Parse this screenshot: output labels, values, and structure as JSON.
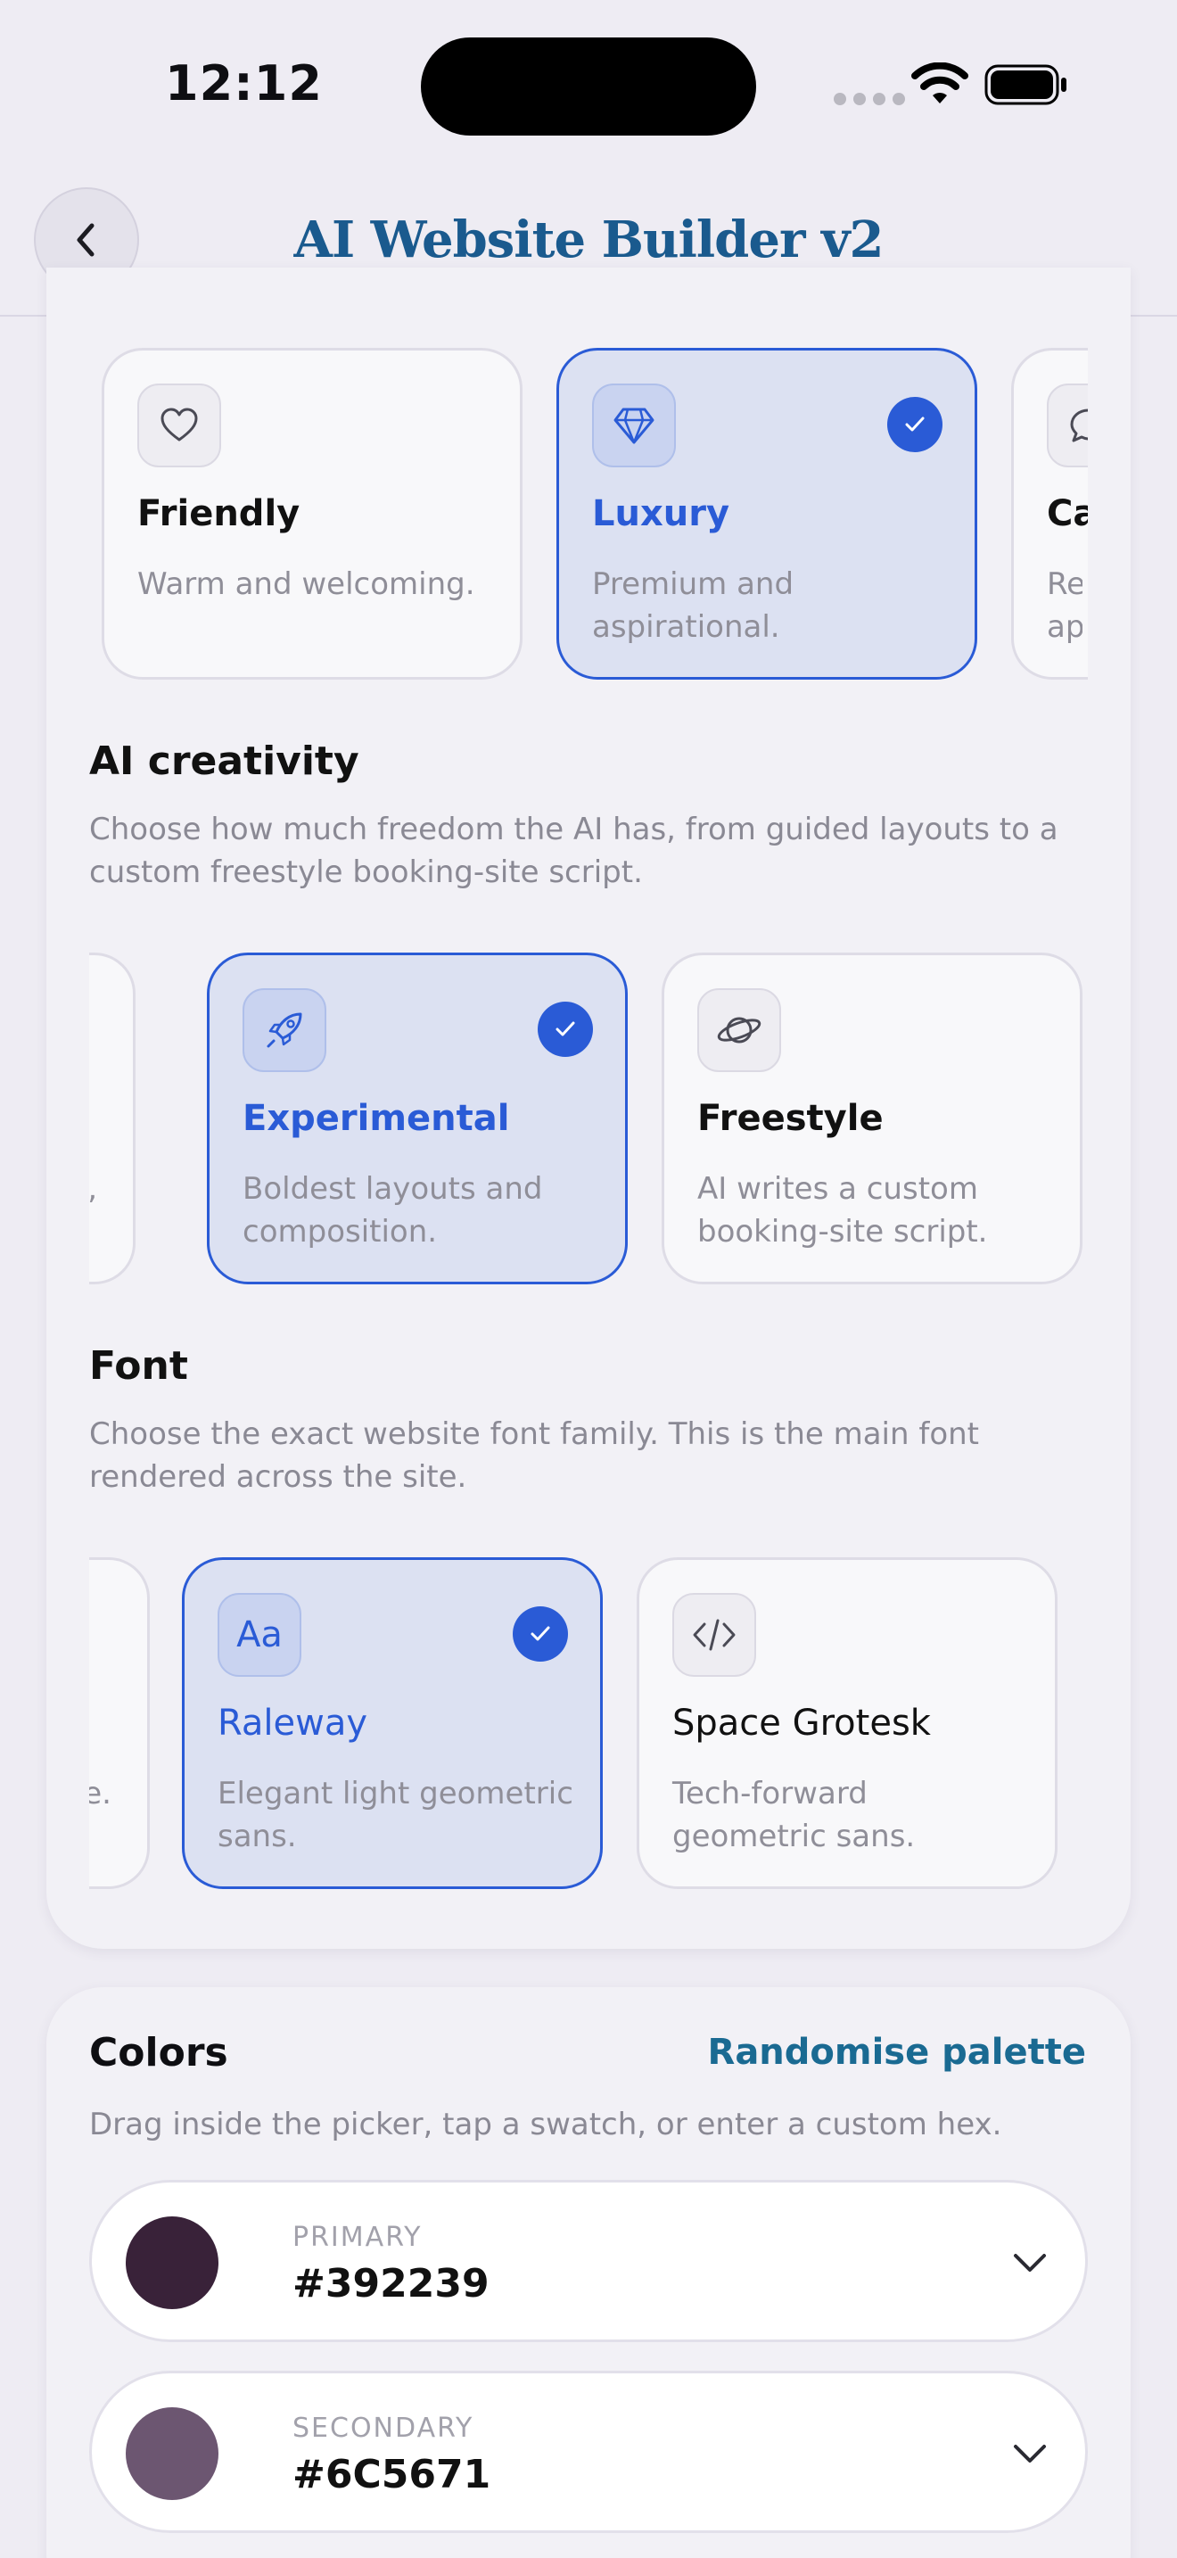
{
  "status_bar": {
    "time": "12:12"
  },
  "header": {
    "title": "AI Website Builder v2"
  },
  "tone": {
    "cards": [
      {
        "title": "Friendly",
        "description": "Warm and welcoming.",
        "icon": "heart-icon",
        "selected": false
      },
      {
        "title": "Luxury",
        "description": "Premium and aspirational.",
        "icon": "diamond-icon",
        "selected": true
      },
      {
        "title": "Ca",
        "description": "Rela app",
        "icon": "chat-bubble-icon",
        "selected": false
      }
    ]
  },
  "creativity": {
    "heading": "AI creativity",
    "description": "Choose how much freedom the AI has, from guided layouts to a custom freestyle booking-site script.",
    "partial_prev_text": "ons,",
    "cards": [
      {
        "title": "Experimental",
        "description": "Boldest layouts and composition.",
        "icon": "rocket-icon",
        "selected": true
      },
      {
        "title": "Freestyle",
        "description": "AI writes a custom booking-site script.",
        "icon": "planet-icon",
        "selected": false
      }
    ]
  },
  "font": {
    "heading": "Font",
    "description": "Choose the exact website font family. This is the main font rendered across the site.",
    "partial_prev_text": "e.",
    "raleway_icon_text": "Aa",
    "cards": [
      {
        "title": "Raleway",
        "description": "Elegant light geometric sans.",
        "icon": "text-aa-icon",
        "selected": true
      },
      {
        "title": "Space Grotesk",
        "description": "Tech-forward geometric sans.",
        "icon": "code-icon",
        "selected": false
      }
    ]
  },
  "colors": {
    "heading": "Colors",
    "randomise_label": "Randomise palette",
    "description": "Drag inside the picker, tap a swatch, or enter a custom hex.",
    "rows": [
      {
        "label": "PRIMARY",
        "hex": "#392239",
        "swatch": "#392239"
      },
      {
        "label": "SECONDARY",
        "hex": "#6C5671",
        "swatch": "#6C5671"
      }
    ]
  },
  "theme": {
    "accent": "#2A5BD6",
    "title_color": "#1A5A8E",
    "link_color": "#1A6A92"
  }
}
